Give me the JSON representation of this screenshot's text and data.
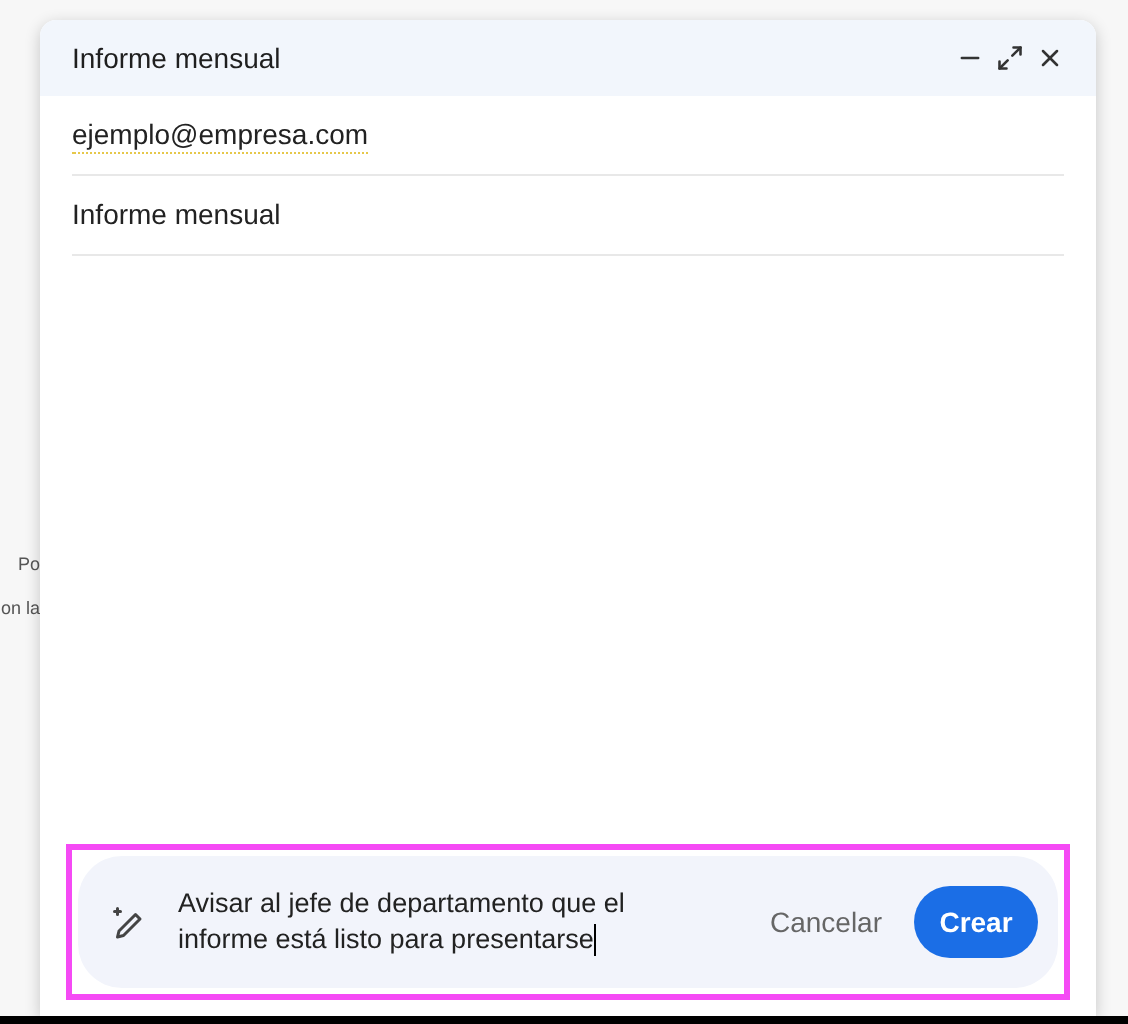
{
  "background_text": [
    "Po",
    "on la"
  ],
  "window": {
    "title": "Informe mensual",
    "controls": [
      {
        "kind": "minimize"
      },
      {
        "kind": "expand"
      },
      {
        "kind": "close"
      }
    ]
  },
  "to": {
    "value": "ejemplo@empresa.com"
  },
  "subject": {
    "value": "Informe mensual"
  },
  "prompt": {
    "highlighted": true,
    "value": "Avisar al jefe de departamento que el informe está listo para presentarse",
    "buttons": [
      "Cancelar",
      "Crear"
    ]
  }
}
